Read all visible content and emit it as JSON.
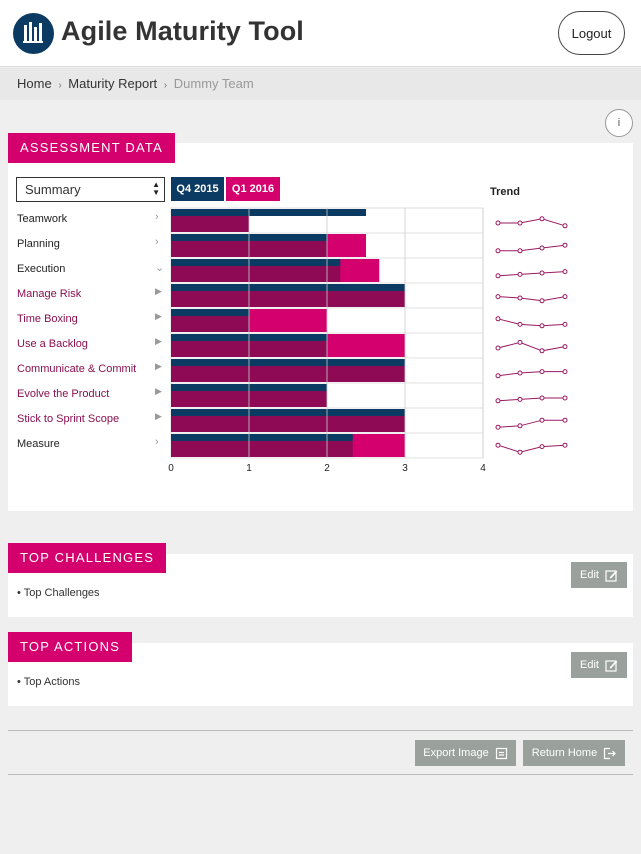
{
  "header": {
    "title": "Agile Maturity Tool",
    "logout_label": "Logout"
  },
  "breadcrumb": {
    "home": "Home",
    "report": "Maturity Report",
    "team": "Dummy Team",
    "separator": "›"
  },
  "info_label": "i",
  "assessment": {
    "tag": "ASSESSMENT DATA",
    "select_value": "Summary",
    "legend": [
      "Q4 2015",
      "Q1 2016"
    ],
    "trend_label": "Trend"
  },
  "chart_data": {
    "type": "bar",
    "orientation": "horizontal",
    "categories": [
      "Teamwork",
      "Planning",
      "Execution",
      "Manage Risk",
      "Time Boxing",
      "Use a Backlog",
      "Communicate & Commit",
      "Evolve the Product",
      "Stick to Sprint Scope",
      "Measure"
    ],
    "series": [
      {
        "name": "Q4 2015",
        "color": "#0b3a63",
        "values": [
          2.5,
          2.0,
          2.17,
          3.0,
          1.0,
          2.0,
          3.0,
          2.0,
          3.0,
          2.33
        ]
      },
      {
        "name": "Q1 2016",
        "color": "#d4006e",
        "values": [
          1.0,
          2.5,
          2.67,
          3.0,
          2.0,
          3.0,
          3.0,
          2.0,
          3.0,
          3.0
        ]
      }
    ],
    "sub_category_flags": [
      false,
      false,
      false,
      true,
      true,
      true,
      true,
      true,
      true,
      false
    ],
    "xlim": [
      0,
      4
    ],
    "xticks": [
      0,
      1,
      2,
      3,
      4
    ],
    "trend_points": [
      [
        0.5,
        0.5,
        0.8,
        0.3
      ],
      [
        0.3,
        0.3,
        0.5,
        0.7
      ],
      [
        0.3,
        0.4,
        0.5,
        0.6
      ],
      [
        0.6,
        0.5,
        0.3,
        0.6
      ],
      [
        0.8,
        0.4,
        0.3,
        0.4
      ],
      [
        0.5,
        0.9,
        0.3,
        0.6
      ],
      [
        0.3,
        0.5,
        0.6,
        0.6
      ],
      [
        0.3,
        0.4,
        0.5,
        0.5
      ],
      [
        0.2,
        0.3,
        0.7,
        0.7
      ],
      [
        0.7,
        0.2,
        0.6,
        0.7
      ]
    ]
  },
  "challenges": {
    "tag": "TOP CHALLENGES",
    "edit_label": "Edit",
    "items": [
      "Top Challenges"
    ]
  },
  "actions": {
    "tag": "TOP ACTIONS",
    "edit_label": "Edit",
    "items": [
      "Top Actions"
    ]
  },
  "footer": {
    "export_label": "Export Image",
    "return_label": "Return Home"
  }
}
